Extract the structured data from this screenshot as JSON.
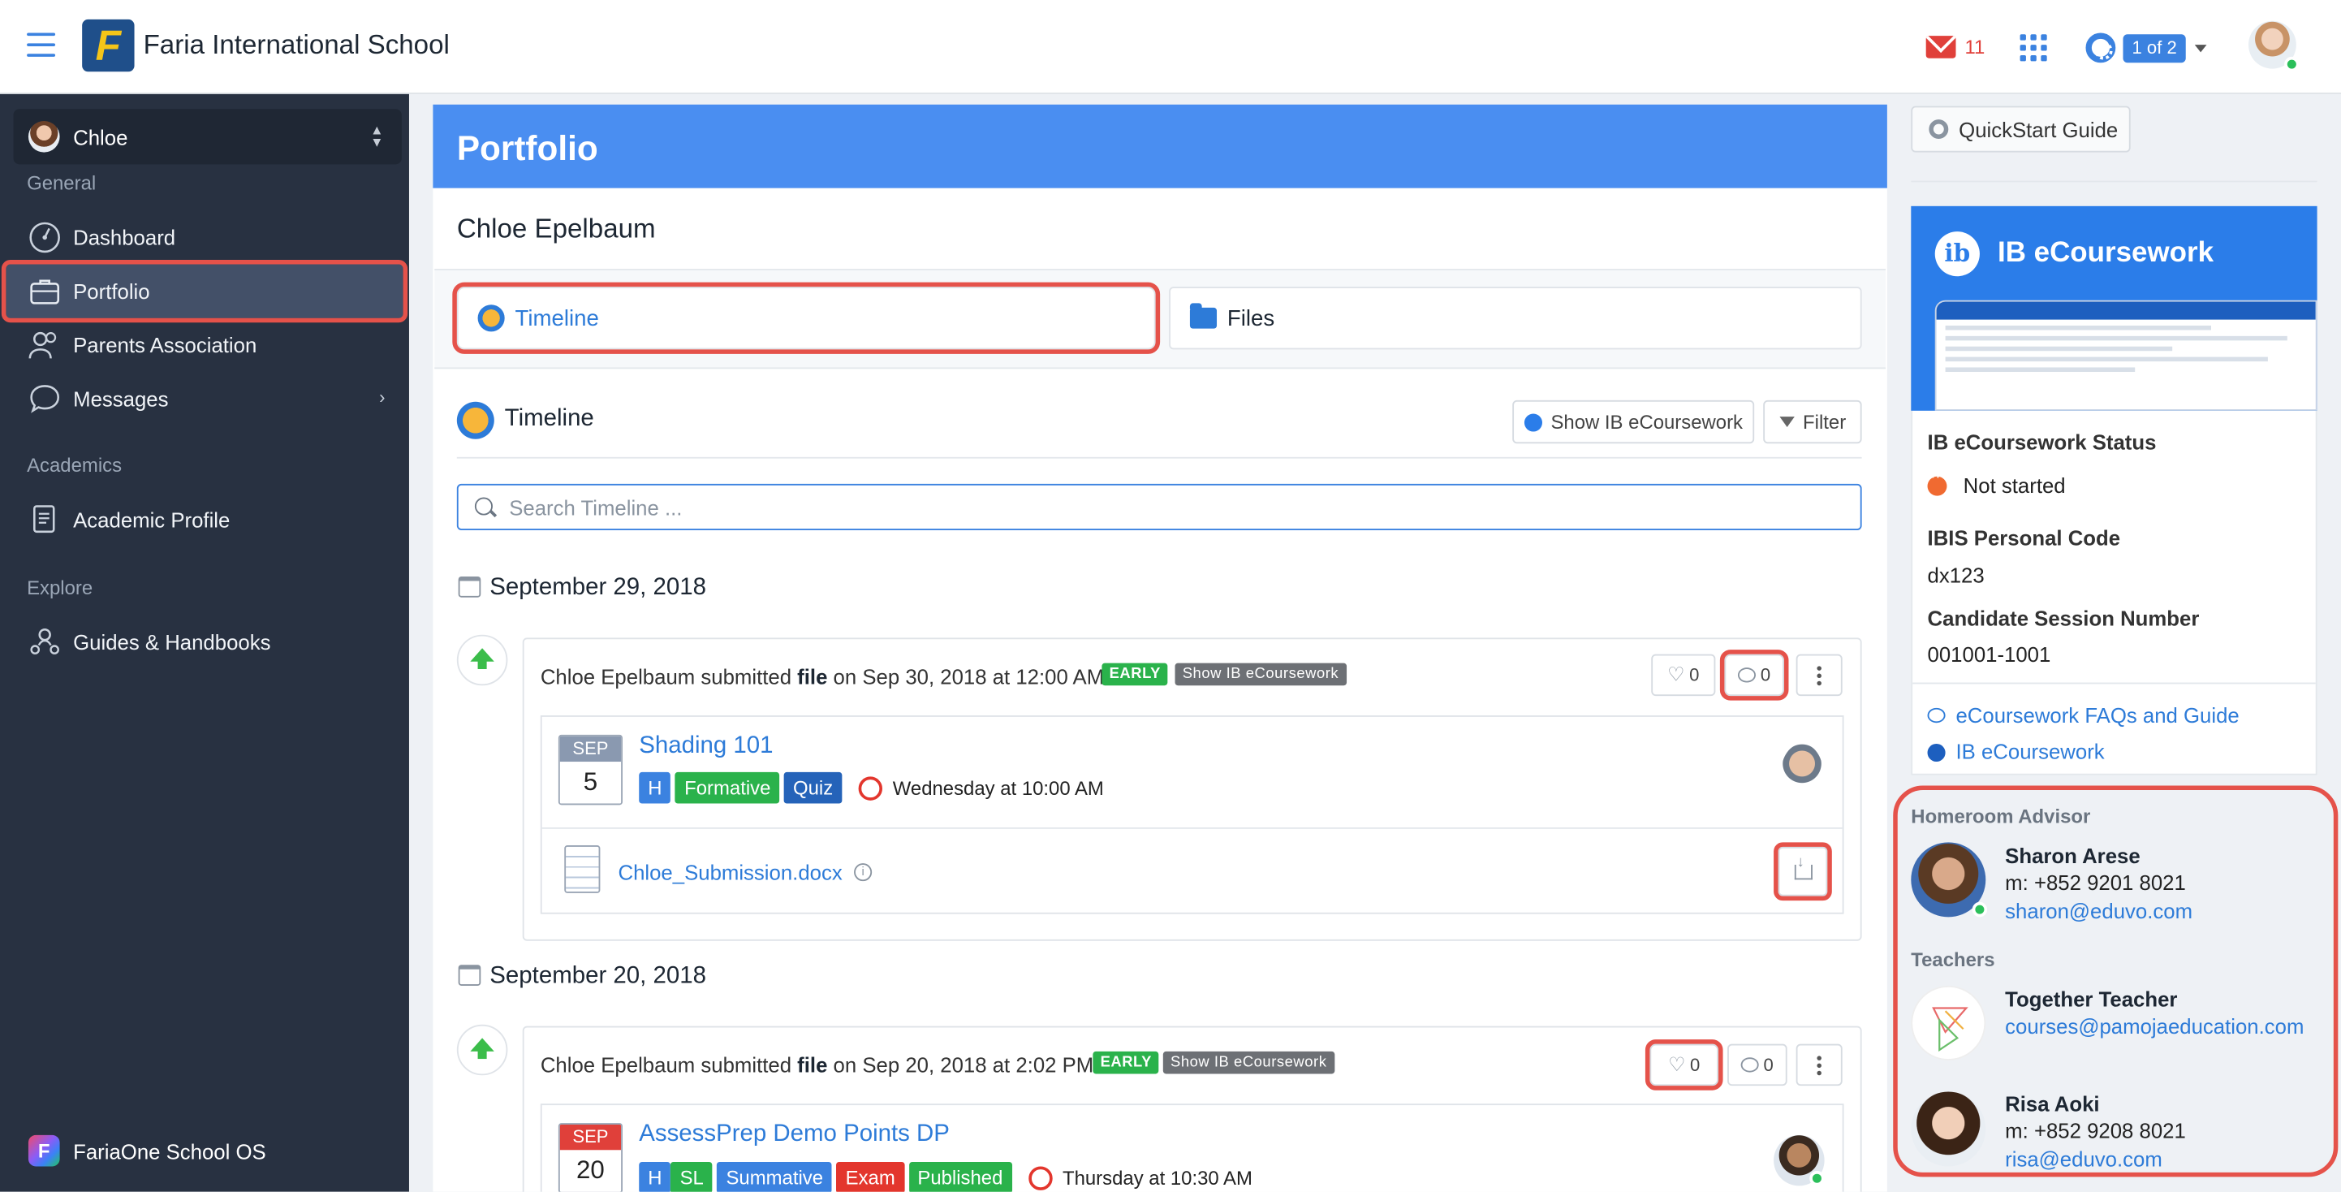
{
  "topbar": {
    "school_name": "Faria International School",
    "logo_letter": "F",
    "mail_count": "11",
    "pager_label": "1 of 2"
  },
  "sidebar": {
    "user_name": "Chloe",
    "sections": {
      "general": "General",
      "academics": "Academics",
      "explore": "Explore"
    },
    "items": {
      "dashboard": "Dashboard",
      "portfolio": "Portfolio",
      "parents_association": "Parents Association",
      "messages": "Messages",
      "academic_profile": "Academic Profile",
      "guides": "Guides & Handbooks"
    },
    "footer": "FariaOne School OS"
  },
  "main": {
    "title": "Portfolio",
    "student_name": "Chloe Epelbaum",
    "tabs": {
      "timeline": "Timeline",
      "files": "Files"
    },
    "timeline_heading": "Timeline",
    "show_ib_button": "Show IB eCoursework",
    "filter_button": "Filter",
    "search_placeholder": "Search Timeline ...",
    "groups": [
      {
        "date": "September 29, 2018",
        "entry": {
          "actor": "Chloe Epelbaum",
          "verb": " submitted ",
          "object": "file",
          "when": " on Sep 30, 2018 at 12:00 AM",
          "status_badge": "EARLY",
          "ib_badge": "Show IB eCoursework",
          "likes": "0",
          "comments": "0",
          "course": {
            "month": "SEP",
            "day": "5",
            "title": "Shading 101",
            "tags": [
              "H",
              "Formative",
              "Quiz"
            ],
            "due": "Wednesday at 10:00 AM"
          },
          "file_name": "Chloe_Submission.docx"
        }
      },
      {
        "date": "September 20, 2018",
        "entry": {
          "actor": "Chloe Epelbaum",
          "verb": " submitted ",
          "object": "file",
          "when": " on Sep 20, 2018 at 2:02 PM",
          "status_badge": "EARLY",
          "ib_badge": "Show IB eCoursework",
          "likes": "0",
          "comments": "0",
          "course": {
            "month": "SEP",
            "day": "20",
            "title": "AssessPrep Demo Points DP",
            "tags": [
              "H",
              "SL",
              "Summative",
              "Exam",
              "Published"
            ],
            "due": "Thursday at 10:30 AM"
          }
        }
      }
    ]
  },
  "right": {
    "quickstart": "QuickStart Guide",
    "ib": {
      "title": "IB eCoursework",
      "logo_letter": "ib",
      "status_label": "IB eCoursework Status",
      "status_value": "Not started",
      "ibis_label": "IBIS Personal Code",
      "ibis_value": "dx123",
      "session_label": "Candidate Session Number",
      "session_value": "001001-1001",
      "faq_link": "eCoursework FAQs and Guide",
      "ib_link": "IB eCoursework"
    },
    "homeroom_label": "Homeroom Advisor",
    "advisor": {
      "name": "Sharon Arese",
      "phone": "m: +852 9201 8021",
      "email": "sharon@eduvo.com"
    },
    "teachers_label": "Teachers",
    "teachers": [
      {
        "name": "Together Teacher",
        "email": "courses@pamojaeducation.com"
      },
      {
        "name": "Risa Aoki",
        "phone": "m: +852 9208 8021",
        "email": "risa@eduvo.com"
      }
    ]
  },
  "colors": {
    "primary": "#4a8ef1",
    "sidebar": "#283141",
    "highlight": "#e5524a",
    "success": "#2ab24b"
  }
}
